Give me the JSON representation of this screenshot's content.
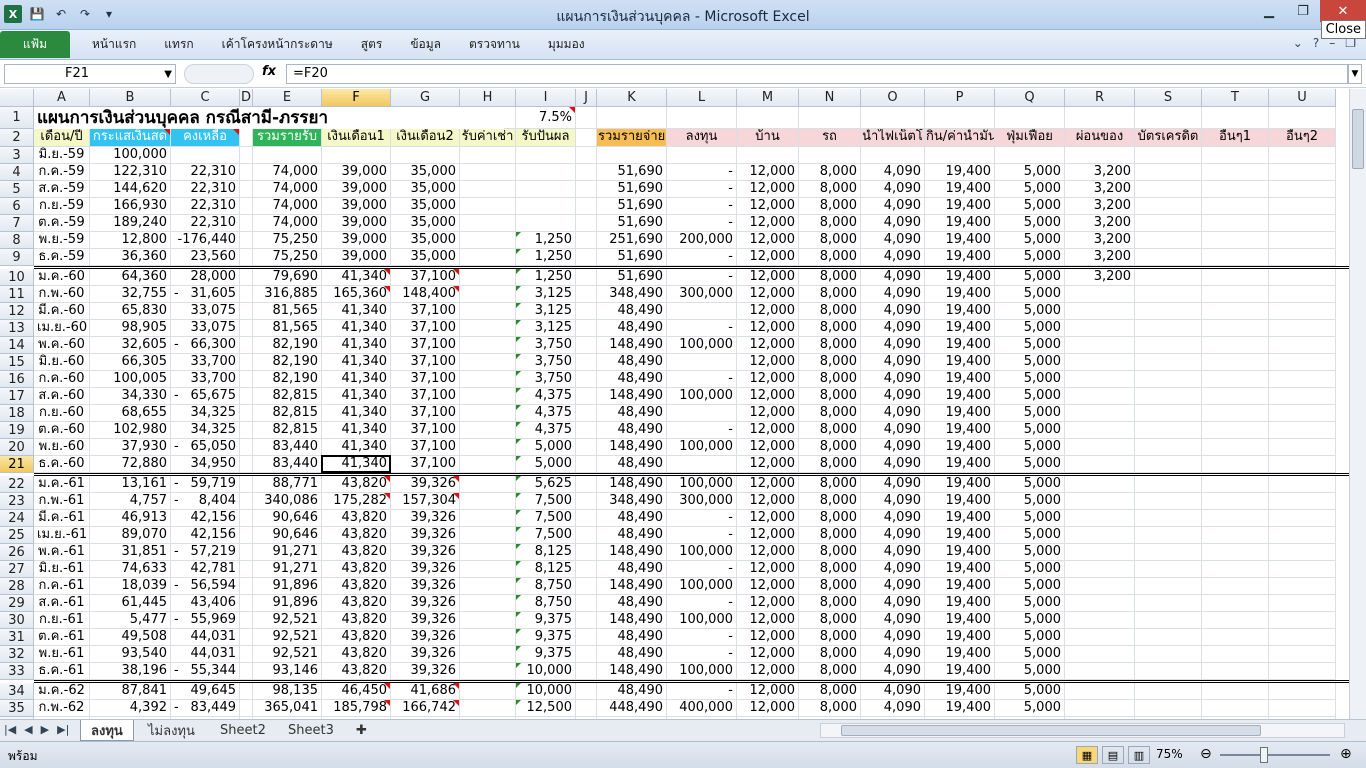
{
  "window": {
    "title": "แผนการเงินส่วนบุคคล  -  Microsoft Excel",
    "close_tooltip": "Close"
  },
  "qat": {
    "logo": "X",
    "save": "💾",
    "undo": "↶",
    "redo": "↷",
    "more": "▾"
  },
  "ribbon": {
    "file_tab": "แฟ้ม",
    "tabs": [
      "หน้าแรก",
      "แทรก",
      "เค้าโครงหน้ากระดาษ",
      "สูตร",
      "ข้อมูล",
      "ตรวจทาน",
      "มุมมอง"
    ]
  },
  "formula_bar": {
    "name_box": "F21",
    "fx": "fx",
    "formula": "=F20"
  },
  "sheet": {
    "columns": [
      "A",
      "B",
      "C",
      "D",
      "E",
      "F",
      "G",
      "H",
      "I",
      "J",
      "K",
      "L",
      "M",
      "N",
      "O",
      "P",
      "Q",
      "R",
      "S",
      "T",
      "U"
    ],
    "selected_col": "F",
    "selected_row": "21",
    "title": "แผนการเงินส่วนบุคคล กรณีสามี-ภรรยา",
    "rate": "7.5%",
    "headers": {
      "A": "เดือน/ปี",
      "B": "กระแสเงินสด",
      "C": "คงเหลือ",
      "E": "รวมรายรับ",
      "F": "เงินเดือน1",
      "G": "เงินเดือน2",
      "H": "รับค่าเช่า",
      "I": "รับปันผล",
      "K": "รวมรายจ่าย",
      "L": "ลงทุน",
      "M": "บ้าน",
      "N": "รถ",
      "O": "น้ำไฟเน็ตโ",
      "P": "กิน/ค่าน้ำมัน",
      "Q": "ฟุ่มเฟือย",
      "R": "ผ่อนของ",
      "S": "บัตรเครดิต",
      "T": "อื่นๆ1",
      "U": "อื่นๆ2"
    },
    "rows": [
      {
        "r": "3",
        "A": "มิ.ย.-59",
        "B": "100,000"
      },
      {
        "r": "4",
        "A": "ก.ค.-59",
        "B": "122,310",
        "C": "22,310",
        "E": "74,000",
        "F": "39,000",
        "G": "35,000",
        "K": "51,690",
        "L": "-",
        "M": "12,000",
        "N": "8,000",
        "O": "4,090",
        "P": "19,400",
        "Q": "5,000",
        "R": "3,200"
      },
      {
        "r": "5",
        "A": "ส.ค.-59",
        "B": "144,620",
        "C": "22,310",
        "E": "74,000",
        "F": "39,000",
        "G": "35,000",
        "K": "51,690",
        "L": "-",
        "M": "12,000",
        "N": "8,000",
        "O": "4,090",
        "P": "19,400",
        "Q": "5,000",
        "R": "3,200"
      },
      {
        "r": "6",
        "A": "ก.ย.-59",
        "B": "166,930",
        "C": "22,310",
        "E": "74,000",
        "F": "39,000",
        "G": "35,000",
        "K": "51,690",
        "L": "-",
        "M": "12,000",
        "N": "8,000",
        "O": "4,090",
        "P": "19,400",
        "Q": "5,000",
        "R": "3,200"
      },
      {
        "r": "7",
        "A": "ต.ค.-59",
        "B": "189,240",
        "C": "22,310",
        "E": "74,000",
        "F": "39,000",
        "G": "35,000",
        "K": "51,690",
        "L": "-",
        "M": "12,000",
        "N": "8,000",
        "O": "4,090",
        "P": "19,400",
        "Q": "5,000",
        "R": "3,200"
      },
      {
        "r": "8",
        "A": "พ.ย.-59",
        "B": "12,800",
        "C": "-176,440",
        "E": "75,250",
        "F": "39,000",
        "G": "35,000",
        "I": "1,250",
        "K": "251,690",
        "L": "200,000",
        "M": "12,000",
        "N": "8,000",
        "O": "4,090",
        "P": "19,400",
        "Q": "5,000",
        "R": "3,200"
      },
      {
        "r": "9",
        "A": "ธ.ค.-59",
        "B": "36,360",
        "C": "23,560",
        "E": "75,250",
        "F": "39,000",
        "G": "35,000",
        "I": "1,250",
        "K": "51,690",
        "L": "-",
        "M": "12,000",
        "N": "8,000",
        "O": "4,090",
        "P": "19,400",
        "Q": "5,000",
        "R": "3,200"
      },
      {
        "r": "10",
        "A": "ม.ค.-60",
        "B": "64,360",
        "C": "28,000",
        "E": "79,690",
        "F": "41,340",
        "G": "37,100",
        "I": "1,250",
        "K": "51,690",
        "L": "-",
        "M": "12,000",
        "N": "8,000",
        "O": "4,090",
        "P": "19,400",
        "Q": "5,000",
        "R": "3,200"
      },
      {
        "r": "11",
        "A": "ก.พ.-60",
        "B": "32,755",
        "C": "-  31,605",
        "E": "316,885",
        "F": "165,360",
        "G": "148,400",
        "I": "3,125",
        "K": "348,490",
        "L": "300,000",
        "M": "12,000",
        "N": "8,000",
        "O": "4,090",
        "P": "19,400",
        "Q": "5,000"
      },
      {
        "r": "12",
        "A": "มี.ค.-60",
        "B": "65,830",
        "C": "33,075",
        "E": "81,565",
        "F": "41,340",
        "G": "37,100",
        "I": "3,125",
        "K": "48,490",
        "M": "12,000",
        "N": "8,000",
        "O": "4,090",
        "P": "19,400",
        "Q": "5,000"
      },
      {
        "r": "13",
        "A": "เม.ย.-60",
        "B": "98,905",
        "C": "33,075",
        "E": "81,565",
        "F": "41,340",
        "G": "37,100",
        "I": "3,125",
        "K": "48,490",
        "L": "-",
        "M": "12,000",
        "N": "8,000",
        "O": "4,090",
        "P": "19,400",
        "Q": "5,000"
      },
      {
        "r": "14",
        "A": "พ.ค.-60",
        "B": "32,605",
        "C": "-  66,300",
        "E": "82,190",
        "F": "41,340",
        "G": "37,100",
        "I": "3,750",
        "K": "148,490",
        "L": "100,000",
        "M": "12,000",
        "N": "8,000",
        "O": "4,090",
        "P": "19,400",
        "Q": "5,000"
      },
      {
        "r": "15",
        "A": "มิ.ย.-60",
        "B": "66,305",
        "C": "33,700",
        "E": "82,190",
        "F": "41,340",
        "G": "37,100",
        "I": "3,750",
        "K": "48,490",
        "M": "12,000",
        "N": "8,000",
        "O": "4,090",
        "P": "19,400",
        "Q": "5,000"
      },
      {
        "r": "16",
        "A": "ก.ค.-60",
        "B": "100,005",
        "C": "33,700",
        "E": "82,190",
        "F": "41,340",
        "G": "37,100",
        "I": "3,750",
        "K": "48,490",
        "L": "-",
        "M": "12,000",
        "N": "8,000",
        "O": "4,090",
        "P": "19,400",
        "Q": "5,000"
      },
      {
        "r": "17",
        "A": "ส.ค.-60",
        "B": "34,330",
        "C": "-  65,675",
        "E": "82,815",
        "F": "41,340",
        "G": "37,100",
        "I": "4,375",
        "K": "148,490",
        "L": "100,000",
        "M": "12,000",
        "N": "8,000",
        "O": "4,090",
        "P": "19,400",
        "Q": "5,000"
      },
      {
        "r": "18",
        "A": "ก.ย.-60",
        "B": "68,655",
        "C": "34,325",
        "E": "82,815",
        "F": "41,340",
        "G": "37,100",
        "I": "4,375",
        "K": "48,490",
        "M": "12,000",
        "N": "8,000",
        "O": "4,090",
        "P": "19,400",
        "Q": "5,000"
      },
      {
        "r": "19",
        "A": "ต.ค.-60",
        "B": "102,980",
        "C": "34,325",
        "E": "82,815",
        "F": "41,340",
        "G": "37,100",
        "I": "4,375",
        "K": "48,490",
        "L": "-",
        "M": "12,000",
        "N": "8,000",
        "O": "4,090",
        "P": "19,400",
        "Q": "5,000"
      },
      {
        "r": "20",
        "A": "พ.ย.-60",
        "B": "37,930",
        "C": "-  65,050",
        "E": "83,440",
        "F": "41,340",
        "G": "37,100",
        "I": "5,000",
        "K": "148,490",
        "L": "100,000",
        "M": "12,000",
        "N": "8,000",
        "O": "4,090",
        "P": "19,400",
        "Q": "5,000"
      },
      {
        "r": "21",
        "A": "ธ.ค.-60",
        "B": "72,880",
        "C": "34,950",
        "E": "83,440",
        "F": "41,340",
        "G": "37,100",
        "I": "5,000",
        "K": "48,490",
        "M": "12,000",
        "N": "8,000",
        "O": "4,090",
        "P": "19,400",
        "Q": "5,000"
      },
      {
        "r": "22",
        "A": "ม.ค.-61",
        "B": "13,161",
        "C": "-  59,719",
        "E": "88,771",
        "F": "43,820",
        "G": "39,326",
        "I": "5,625",
        "K": "148,490",
        "L": "100,000",
        "M": "12,000",
        "N": "8,000",
        "O": "4,090",
        "P": "19,400",
        "Q": "5,000"
      },
      {
        "r": "23",
        "A": "ก.พ.-61",
        "B": "4,757",
        "C": "-    8,404",
        "E": "340,086",
        "F": "175,282",
        "G": "157,304",
        "I": "7,500",
        "K": "348,490",
        "L": "300,000",
        "M": "12,000",
        "N": "8,000",
        "O": "4,090",
        "P": "19,400",
        "Q": "5,000"
      },
      {
        "r": "24",
        "A": "มี.ค.-61",
        "B": "46,913",
        "C": "42,156",
        "E": "90,646",
        "F": "43,820",
        "G": "39,326",
        "I": "7,500",
        "K": "48,490",
        "L": "-",
        "M": "12,000",
        "N": "8,000",
        "O": "4,090",
        "P": "19,400",
        "Q": "5,000"
      },
      {
        "r": "25",
        "A": "เม.ย.-61",
        "B": "89,070",
        "C": "42,156",
        "E": "90,646",
        "F": "43,820",
        "G": "39,326",
        "I": "7,500",
        "K": "48,490",
        "L": "-",
        "M": "12,000",
        "N": "8,000",
        "O": "4,090",
        "P": "19,400",
        "Q": "5,000"
      },
      {
        "r": "26",
        "A": "พ.ค.-61",
        "B": "31,851",
        "C": "-  57,219",
        "E": "91,271",
        "F": "43,820",
        "G": "39,326",
        "I": "8,125",
        "K": "148,490",
        "L": "100,000",
        "M": "12,000",
        "N": "8,000",
        "O": "4,090",
        "P": "19,400",
        "Q": "5,000"
      },
      {
        "r": "27",
        "A": "มิ.ย.-61",
        "B": "74,633",
        "C": "42,781",
        "E": "91,271",
        "F": "43,820",
        "G": "39,326",
        "I": "8,125",
        "K": "48,490",
        "L": "-",
        "M": "12,000",
        "N": "8,000",
        "O": "4,090",
        "P": "19,400",
        "Q": "5,000"
      },
      {
        "r": "28",
        "A": "ก.ค.-61",
        "B": "18,039",
        "C": "-  56,594",
        "E": "91,896",
        "F": "43,820",
        "G": "39,326",
        "I": "8,750",
        "K": "148,490",
        "L": "100,000",
        "M": "12,000",
        "N": "8,000",
        "O": "4,090",
        "P": "19,400",
        "Q": "5,000"
      },
      {
        "r": "29",
        "A": "ส.ค.-61",
        "B": "61,445",
        "C": "43,406",
        "E": "91,896",
        "F": "43,820",
        "G": "39,326",
        "I": "8,750",
        "K": "48,490",
        "L": "-",
        "M": "12,000",
        "N": "8,000",
        "O": "4,090",
        "P": "19,400",
        "Q": "5,000"
      },
      {
        "r": "30",
        "A": "ก.ย.-61",
        "B": "5,477",
        "C": "-  55,969",
        "E": "92,521",
        "F": "43,820",
        "G": "39,326",
        "I": "9,375",
        "K": "148,490",
        "L": "100,000",
        "M": "12,000",
        "N": "8,000",
        "O": "4,090",
        "P": "19,400",
        "Q": "5,000"
      },
      {
        "r": "31",
        "A": "ต.ค.-61",
        "B": "49,508",
        "C": "44,031",
        "E": "92,521",
        "F": "43,820",
        "G": "39,326",
        "I": "9,375",
        "K": "48,490",
        "L": "-",
        "M": "12,000",
        "N": "8,000",
        "O": "4,090",
        "P": "19,400",
        "Q": "5,000"
      },
      {
        "r": "32",
        "A": "พ.ย.-61",
        "B": "93,540",
        "C": "44,031",
        "E": "92,521",
        "F": "43,820",
        "G": "39,326",
        "I": "9,375",
        "K": "48,490",
        "L": "-",
        "M": "12,000",
        "N": "8,000",
        "O": "4,090",
        "P": "19,400",
        "Q": "5,000"
      },
      {
        "r": "33",
        "A": "ธ.ค.-61",
        "B": "38,196",
        "C": "-  55,344",
        "E": "93,146",
        "F": "43,820",
        "G": "39,326",
        "I": "10,000",
        "K": "148,490",
        "L": "100,000",
        "M": "12,000",
        "N": "8,000",
        "O": "4,090",
        "P": "19,400",
        "Q": "5,000"
      },
      {
        "r": "34",
        "A": "ม.ค.-62",
        "B": "87,841",
        "C": "49,645",
        "E": "98,135",
        "F": "46,450",
        "G": "41,686",
        "I": "10,000",
        "K": "48,490",
        "L": "-",
        "M": "12,000",
        "N": "8,000",
        "O": "4,090",
        "P": "19,400",
        "Q": "5,000"
      },
      {
        "r": "35",
        "A": "ก.พ.-62",
        "B": "4,392",
        "C": "-  83,449",
        "E": "365,041",
        "F": "185,798",
        "G": "166,742",
        "I": "12,500",
        "K": "448,490",
        "L": "400,000",
        "M": "12,000",
        "N": "8,000",
        "O": "4,090",
        "P": "19,400",
        "Q": "5,000"
      }
    ]
  },
  "sheet_tabs": [
    "ลงทุน",
    "ไม่ลงทุน",
    "Sheet2",
    "Sheet3"
  ],
  "status": {
    "ready": "พร้อม",
    "zoom": "75%"
  },
  "colors": {
    "blue_header": "#33c3f0",
    "green_header": "#2fb45a",
    "pink_header": "#f6d6d8",
    "orange_header": "#f7bd55",
    "yellow_header": "#f4f7c6",
    "selection": "#f1c860"
  }
}
